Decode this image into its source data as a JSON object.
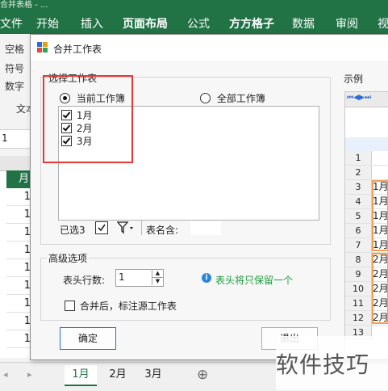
{
  "app": {
    "title_partial": "合并表格 - ...",
    "ribbon_tabs": [
      "文件",
      "开始",
      "插入",
      "页面布局",
      "公式",
      "方方格子",
      "数据",
      "审阅",
      "视"
    ],
    "active_tabs": [
      "页面布局",
      "方方格子"
    ],
    "ribbon_items": [
      "空格",
      "符号",
      "数字",
      "文本"
    ],
    "name_box": "1",
    "column_header": "月",
    "left_cells": [
      "1",
      "1",
      "1",
      "1",
      "1",
      "1",
      "1",
      "1",
      "1"
    ]
  },
  "dialog": {
    "title": "合并工作表",
    "select_group_title": "选择工作表",
    "radio_current": "当前工作簿",
    "radio_all": "全部工作簿",
    "radio_current_selected": true,
    "sheets": [
      {
        "label": "1月",
        "checked": true
      },
      {
        "label": "2月",
        "checked": true
      },
      {
        "label": "3月",
        "checked": true
      }
    ],
    "selected_count_label": "已选3",
    "sheetname_label": "表名含:",
    "sheetname_value": "",
    "advanced_group_title": "高级选项",
    "header_rows_label": "表头行数:",
    "header_rows_value": "1",
    "info_text": "表头将只保留一个",
    "mark_source_label": "合并后，标注源工作表",
    "mark_source_checked": false,
    "ok_label": "确定",
    "cancel_label": "退出",
    "highlight_color": "#e53935",
    "info_color": "#1a9d3c"
  },
  "preview": {
    "title": "示例",
    "row_numbers": [
      "1",
      "2",
      "3",
      "4",
      "5",
      "6",
      "7",
      "8",
      "9",
      "10",
      "11",
      "12",
      "13"
    ],
    "row_values": [
      "",
      "",
      "1月",
      "1月",
      "1月",
      "1月",
      "1月",
      "2月",
      "2月",
      "2月",
      "2月",
      "2月",
      ""
    ],
    "group_color": "#f0a050"
  },
  "sheet_tabs": {
    "tabs": [
      "1月",
      "2月",
      "3月"
    ],
    "active": "1月",
    "add_label": "⊕"
  },
  "watermark": {
    "text": "软件技巧"
  }
}
